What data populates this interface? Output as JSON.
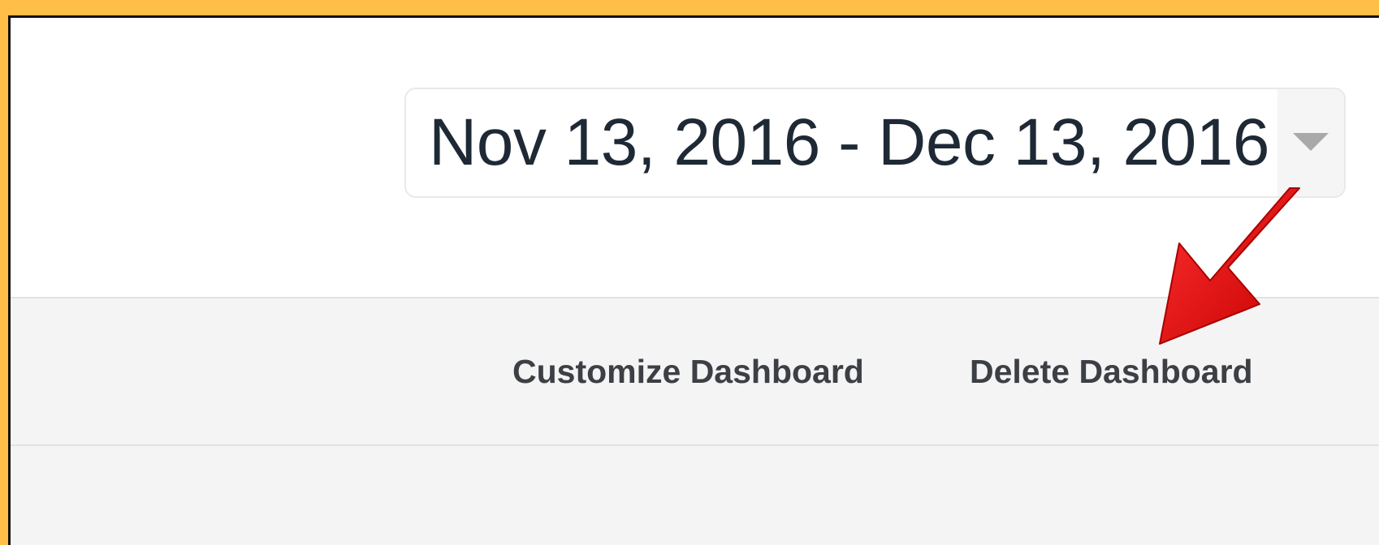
{
  "date_range": {
    "label": "Nov 13, 2016 - Dec 13, 2016"
  },
  "toolbar": {
    "customize_label": "Customize Dashboard",
    "delete_label": "Delete Dashboard"
  },
  "colors": {
    "background_accent": "#FFBE47",
    "annotation_arrow": "#E01010",
    "toolbar_bg": "#F4F4F4",
    "date_text": "#1E2935"
  },
  "icons": {
    "dropdown": "chevron-down-icon",
    "annotation": "red-arrow-annotation"
  }
}
